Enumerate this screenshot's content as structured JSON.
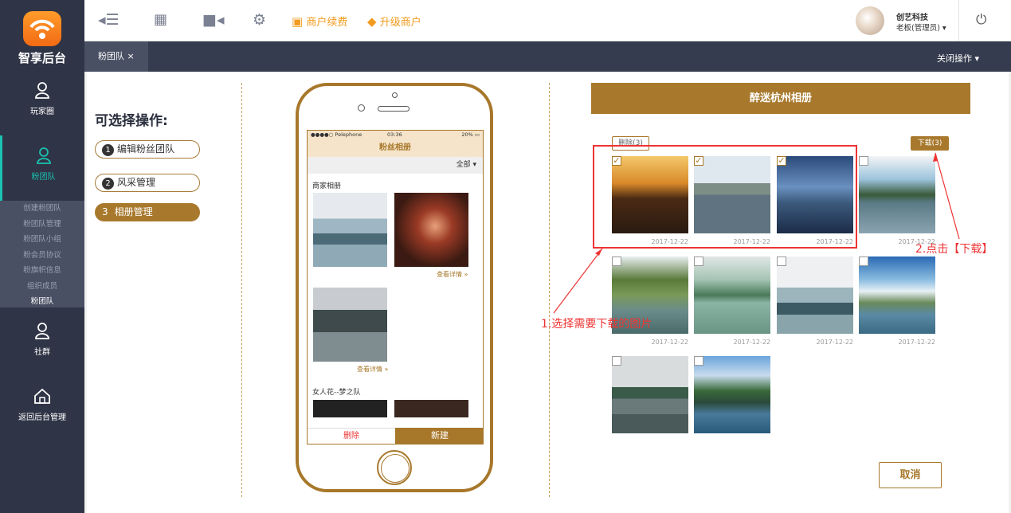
{
  "sidebar": {
    "logo": "智享后台",
    "items": [
      {
        "label": "玩家圈"
      },
      {
        "label": "粉团队"
      },
      {
        "label": "社群"
      },
      {
        "label": "返回后台管理"
      }
    ],
    "submenu": [
      "创建粉团队",
      "粉团队管理",
      "粉团队小组",
      "粉会员协议",
      "粉旗帜信息",
      "组织成员",
      "粉团队"
    ]
  },
  "topbar": {
    "merchant_renew": "商户续费",
    "upgrade": "升级商户",
    "user_name": "创艺科技",
    "user_role": "老板(管理员) ▾"
  },
  "tabs": {
    "active": "粉团队 ×",
    "close_ops": "关闭操作 ▾"
  },
  "ops": {
    "title": "可选择操作:",
    "items": [
      {
        "num": "1",
        "label": "编辑粉丝团队"
      },
      {
        "num": "2",
        "label": "风采管理"
      },
      {
        "num": "3",
        "label": "相册管理"
      }
    ]
  },
  "phone": {
    "carrier": "●●●●○ Pelephone",
    "time": "03:36",
    "battery": "20%",
    "title": "粉丝相册",
    "filter": "全部 ▾",
    "section1": "商家相册",
    "detail": "查看详情 »",
    "section2": "女人花--梦之队",
    "del": "删除",
    "new": "新建"
  },
  "album": {
    "title": "醉迷杭州相册",
    "delete_btn": "删除(3)",
    "download_btn": "下载(3)",
    "date": "2017-12-22",
    "cancel": "取消"
  },
  "annotations": {
    "a1": "1.选择需要下载的图片",
    "a2": "2.点击【下载】"
  },
  "colors": {
    "accent": "#a8792d",
    "sidebar": "#2f3446",
    "annotation": "#e33333"
  }
}
